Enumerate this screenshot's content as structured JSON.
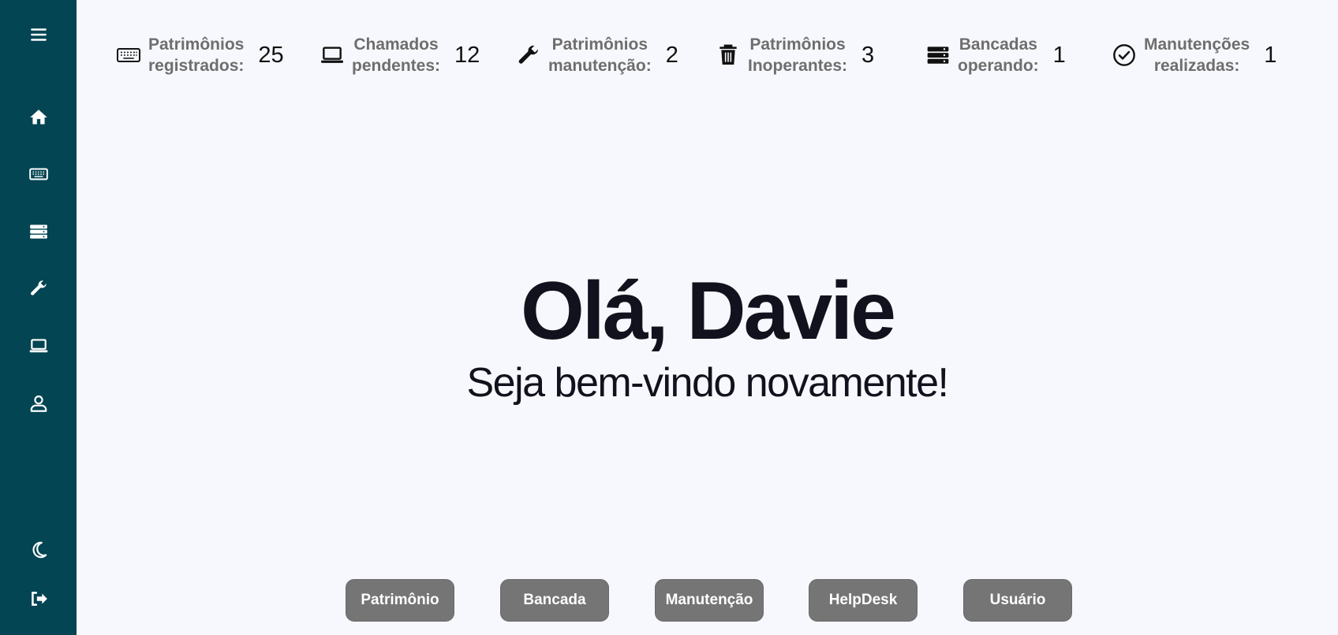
{
  "sidebar": {
    "items": [
      {
        "name": "menu",
        "icon": "hamburger-icon"
      },
      {
        "name": "home",
        "icon": "home-icon"
      },
      {
        "name": "patrimonio",
        "icon": "keyboard-icon"
      },
      {
        "name": "bancada",
        "icon": "server-icon"
      },
      {
        "name": "manutencao",
        "icon": "wrench-icon"
      },
      {
        "name": "helpdesk",
        "icon": "laptop-icon"
      },
      {
        "name": "usuario",
        "icon": "user-icon"
      },
      {
        "name": "theme",
        "icon": "moon-icon"
      },
      {
        "name": "logout",
        "icon": "sign-out-icon"
      }
    ],
    "color": "#034553"
  },
  "stats": [
    {
      "line1": "Patrimônios",
      "line2": "registrados:",
      "value": "25",
      "icon": "keyboard-icon"
    },
    {
      "line1": "Chamados",
      "line2": "pendentes:",
      "value": "12",
      "icon": "laptop-icon"
    },
    {
      "line1": "Patrimônios",
      "line2": "manutenção:",
      "value": "2",
      "icon": "wrench-icon"
    },
    {
      "line1": "Patrimônios",
      "line2": "Inoperantes:",
      "value": "3",
      "icon": "trash-icon"
    },
    {
      "line1": "Bancadas",
      "line2": "operando:",
      "value": "1",
      "icon": "server-icon"
    },
    {
      "line1": "Manutenções",
      "line2": "realizadas:",
      "value": "1",
      "icon": "check-circle-icon"
    }
  ],
  "greeting": {
    "title": "Olá, Davie",
    "subtitle": "Seja bem-vindo novamente!"
  },
  "buttons": [
    "Patrimônio",
    "Bancada",
    "Manutenção",
    "HelpDesk",
    "Usuário"
  ],
  "colors": {
    "background": "#f7f8fd",
    "button": "#757575",
    "text": "#11121d"
  }
}
